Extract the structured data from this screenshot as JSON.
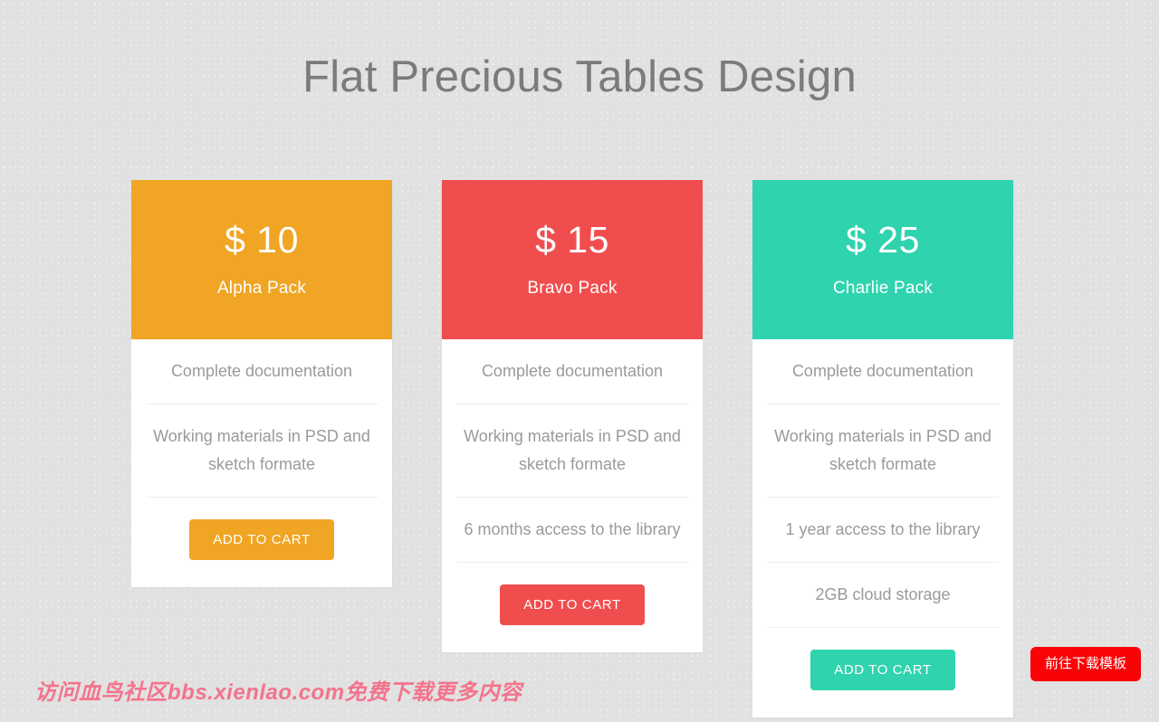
{
  "page": {
    "title": "Flat Precious Tables Design",
    "background_color": "#eaeaea",
    "title_color": "#7b7b7b"
  },
  "cards": [
    {
      "price": "$ 10",
      "name": "Alpha Pack",
      "accent_color": "#f0a524",
      "features": [
        "Complete documentation",
        "Working materials in PSD and sketch formate"
      ],
      "cta_label": "ADD TO CART"
    },
    {
      "price": "$ 15",
      "name": "Bravo Pack",
      "accent_color": "#f04e4e",
      "features": [
        "Complete documentation",
        "Working materials in PSD and sketch formate",
        "6 months access to the library"
      ],
      "cta_label": "ADD TO CART"
    },
    {
      "price": "$ 25",
      "name": "Charlie Pack",
      "accent_color": "#2fd3ae",
      "features": [
        "Complete documentation",
        "Working materials in PSD and sketch formate",
        "1 year access to the library",
        "2GB cloud storage"
      ],
      "cta_label": "ADD TO CART"
    }
  ],
  "watermark": {
    "text": "访问血鸟社区bbs.xienlao.com免费下载更多内容",
    "color": "#f4738c"
  },
  "download_button": {
    "label": "前往下载模板",
    "color": "#fb0207"
  }
}
